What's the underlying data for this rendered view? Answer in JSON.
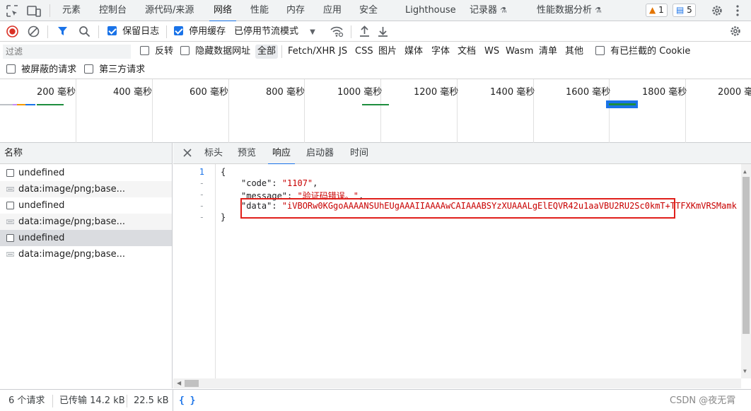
{
  "top_tabs": {
    "items": [
      "元素",
      "控制台",
      "源代码/来源",
      "网络",
      "性能",
      "内存",
      "应用",
      "安全",
      "Lighthouse",
      "记录器",
      "性能数据分析"
    ],
    "active": "网络",
    "warnings_count": "1",
    "messages_count": "5"
  },
  "toolbar": {
    "preserve_log_label": "保留日志",
    "preserve_log_checked": true,
    "disable_cache_label": "停用缓存",
    "disable_cache_checked": true,
    "throttling_value": "已停用节流模式"
  },
  "filter": {
    "placeholder": "过滤",
    "invert_label": "反转",
    "hide_data_urls_label": "隐藏数据网址",
    "types": [
      "全部",
      "Fetch/XHR",
      "JS",
      "CSS",
      "图片",
      "媒体",
      "字体",
      "文档",
      "WS",
      "Wasm",
      "清单",
      "其他"
    ],
    "selected_type": "全部",
    "blocked_cookies_label": "有已拦截的 Cookie",
    "blocked_requests_label": "被屏蔽的请求",
    "third_party_label": "第三方请求"
  },
  "overview": {
    "ticks": [
      "200 毫秒",
      "400 毫秒",
      "600 毫秒",
      "800 毫秒",
      "1000 毫秒",
      "1200 毫秒",
      "1400 毫秒",
      "1600 毫秒",
      "1800 毫秒",
      "2000 毫"
    ]
  },
  "requests": {
    "header": "名称",
    "rows": [
      {
        "name": "undefined",
        "type": "doc"
      },
      {
        "name": "data:image/png;base...",
        "type": "img"
      },
      {
        "name": "undefined",
        "type": "doc"
      },
      {
        "name": "data:image/png;base...",
        "type": "img"
      },
      {
        "name": "undefined",
        "type": "doc"
      },
      {
        "name": "data:image/png;base...",
        "type": "img"
      }
    ],
    "selected_index": 4
  },
  "detail": {
    "tabs": [
      "标头",
      "预览",
      "响应",
      "启动器",
      "时间"
    ],
    "active_tab": "响应",
    "gutter": [
      "1",
      "-",
      "-",
      "-",
      "-"
    ],
    "lines": {
      "l1": "{",
      "code_key": "\"code\"",
      "code_val": "\"1107\"",
      "message_key": "\"message\"",
      "message_val": "\"验证码错误。\"",
      "data_key": "\"data\"",
      "data_val": "\"iVBORw0KGgoAAAANSUhEUgAAAIIAAAAwCAIAAABSYzXUAAALgElEQVR42u1aaVBU2RU2Sc0kmT+TTFXKmVRSMamk",
      "l5": "}"
    }
  },
  "status": {
    "requests": "6 个请求",
    "transferred": "已传输 14.2 kB",
    "resources": "22.5 kB",
    "pretty_print": "{ }",
    "watermark": "CSDN @夜无霄"
  }
}
